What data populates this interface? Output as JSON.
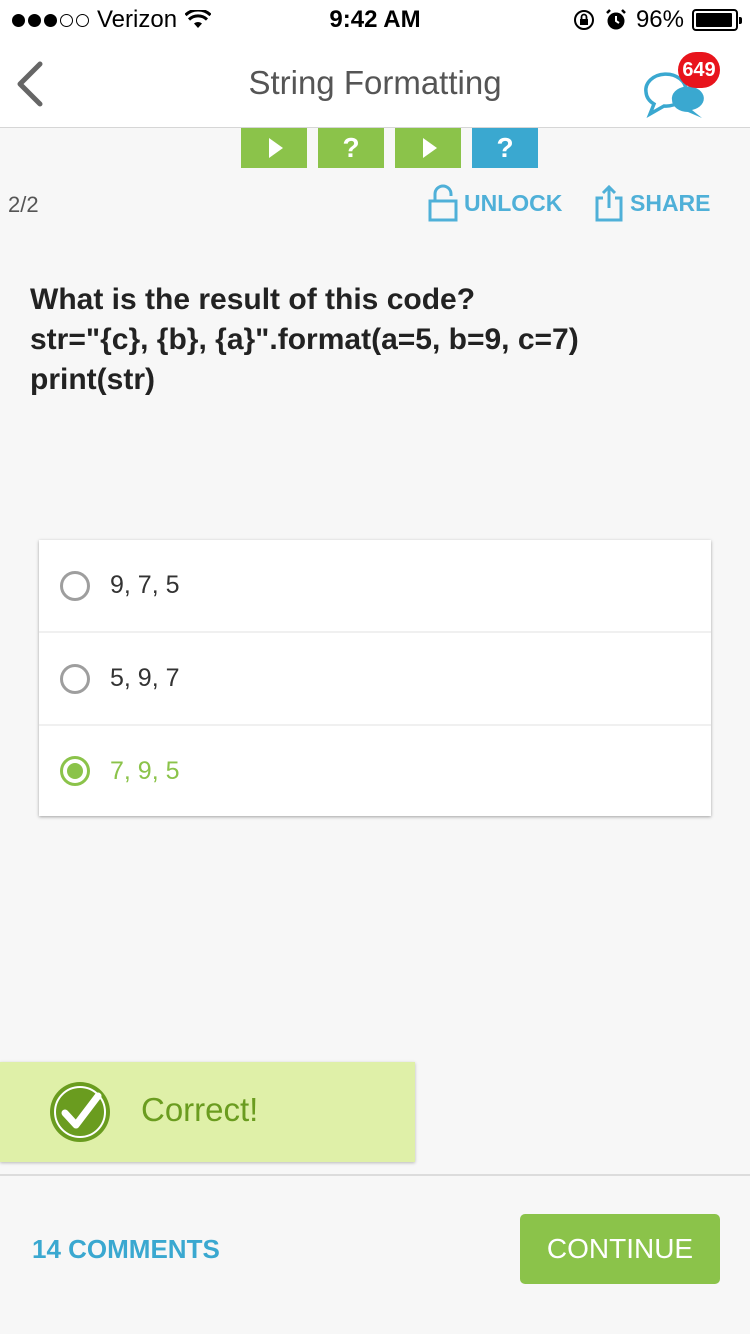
{
  "status_bar": {
    "carrier": "Verizon",
    "time": "9:42 AM",
    "battery_percent": "96%",
    "battery_level": 0.96,
    "signal_bars_filled": 3,
    "signal_bars_total": 5
  },
  "nav": {
    "title": "String Formatting",
    "notification_count": "649",
    "back_icon": "chevron-left-icon",
    "chat_icon": "chat-bubbles-icon"
  },
  "progress_tabs": [
    {
      "type": "play",
      "color": "#8bc34a"
    },
    {
      "type": "question",
      "label": "?",
      "color": "#8bc34a"
    },
    {
      "type": "play",
      "color": "#8bc34a"
    },
    {
      "type": "question",
      "label": "?",
      "color": "#3aa8d0"
    }
  ],
  "toolbar": {
    "counter": "2/2",
    "unlock_label": "UNLOCK",
    "share_label": "SHARE"
  },
  "question": {
    "lines": [
      "What is the result of this code?",
      "str=\"{c}, {b}, {a}\".format(a=5, b=9, c=7)",
      "print(str)"
    ]
  },
  "options": [
    {
      "label": "9, 7, 5",
      "selected": false
    },
    {
      "label": "5, 9, 7",
      "selected": false
    },
    {
      "label": "7, 9, 5",
      "selected": true
    }
  ],
  "feedback": {
    "text": "Correct!",
    "icon": "check-circle-icon"
  },
  "bottom": {
    "comments_label": "14 COMMENTS",
    "continue_label": "CONTINUE"
  },
  "colors": {
    "accent_green": "#8bc34a",
    "accent_blue": "#3aa8d0",
    "badge_red": "#e8141c",
    "feedback_bg": "#dff0a8",
    "feedback_text": "#6a9c1f"
  }
}
